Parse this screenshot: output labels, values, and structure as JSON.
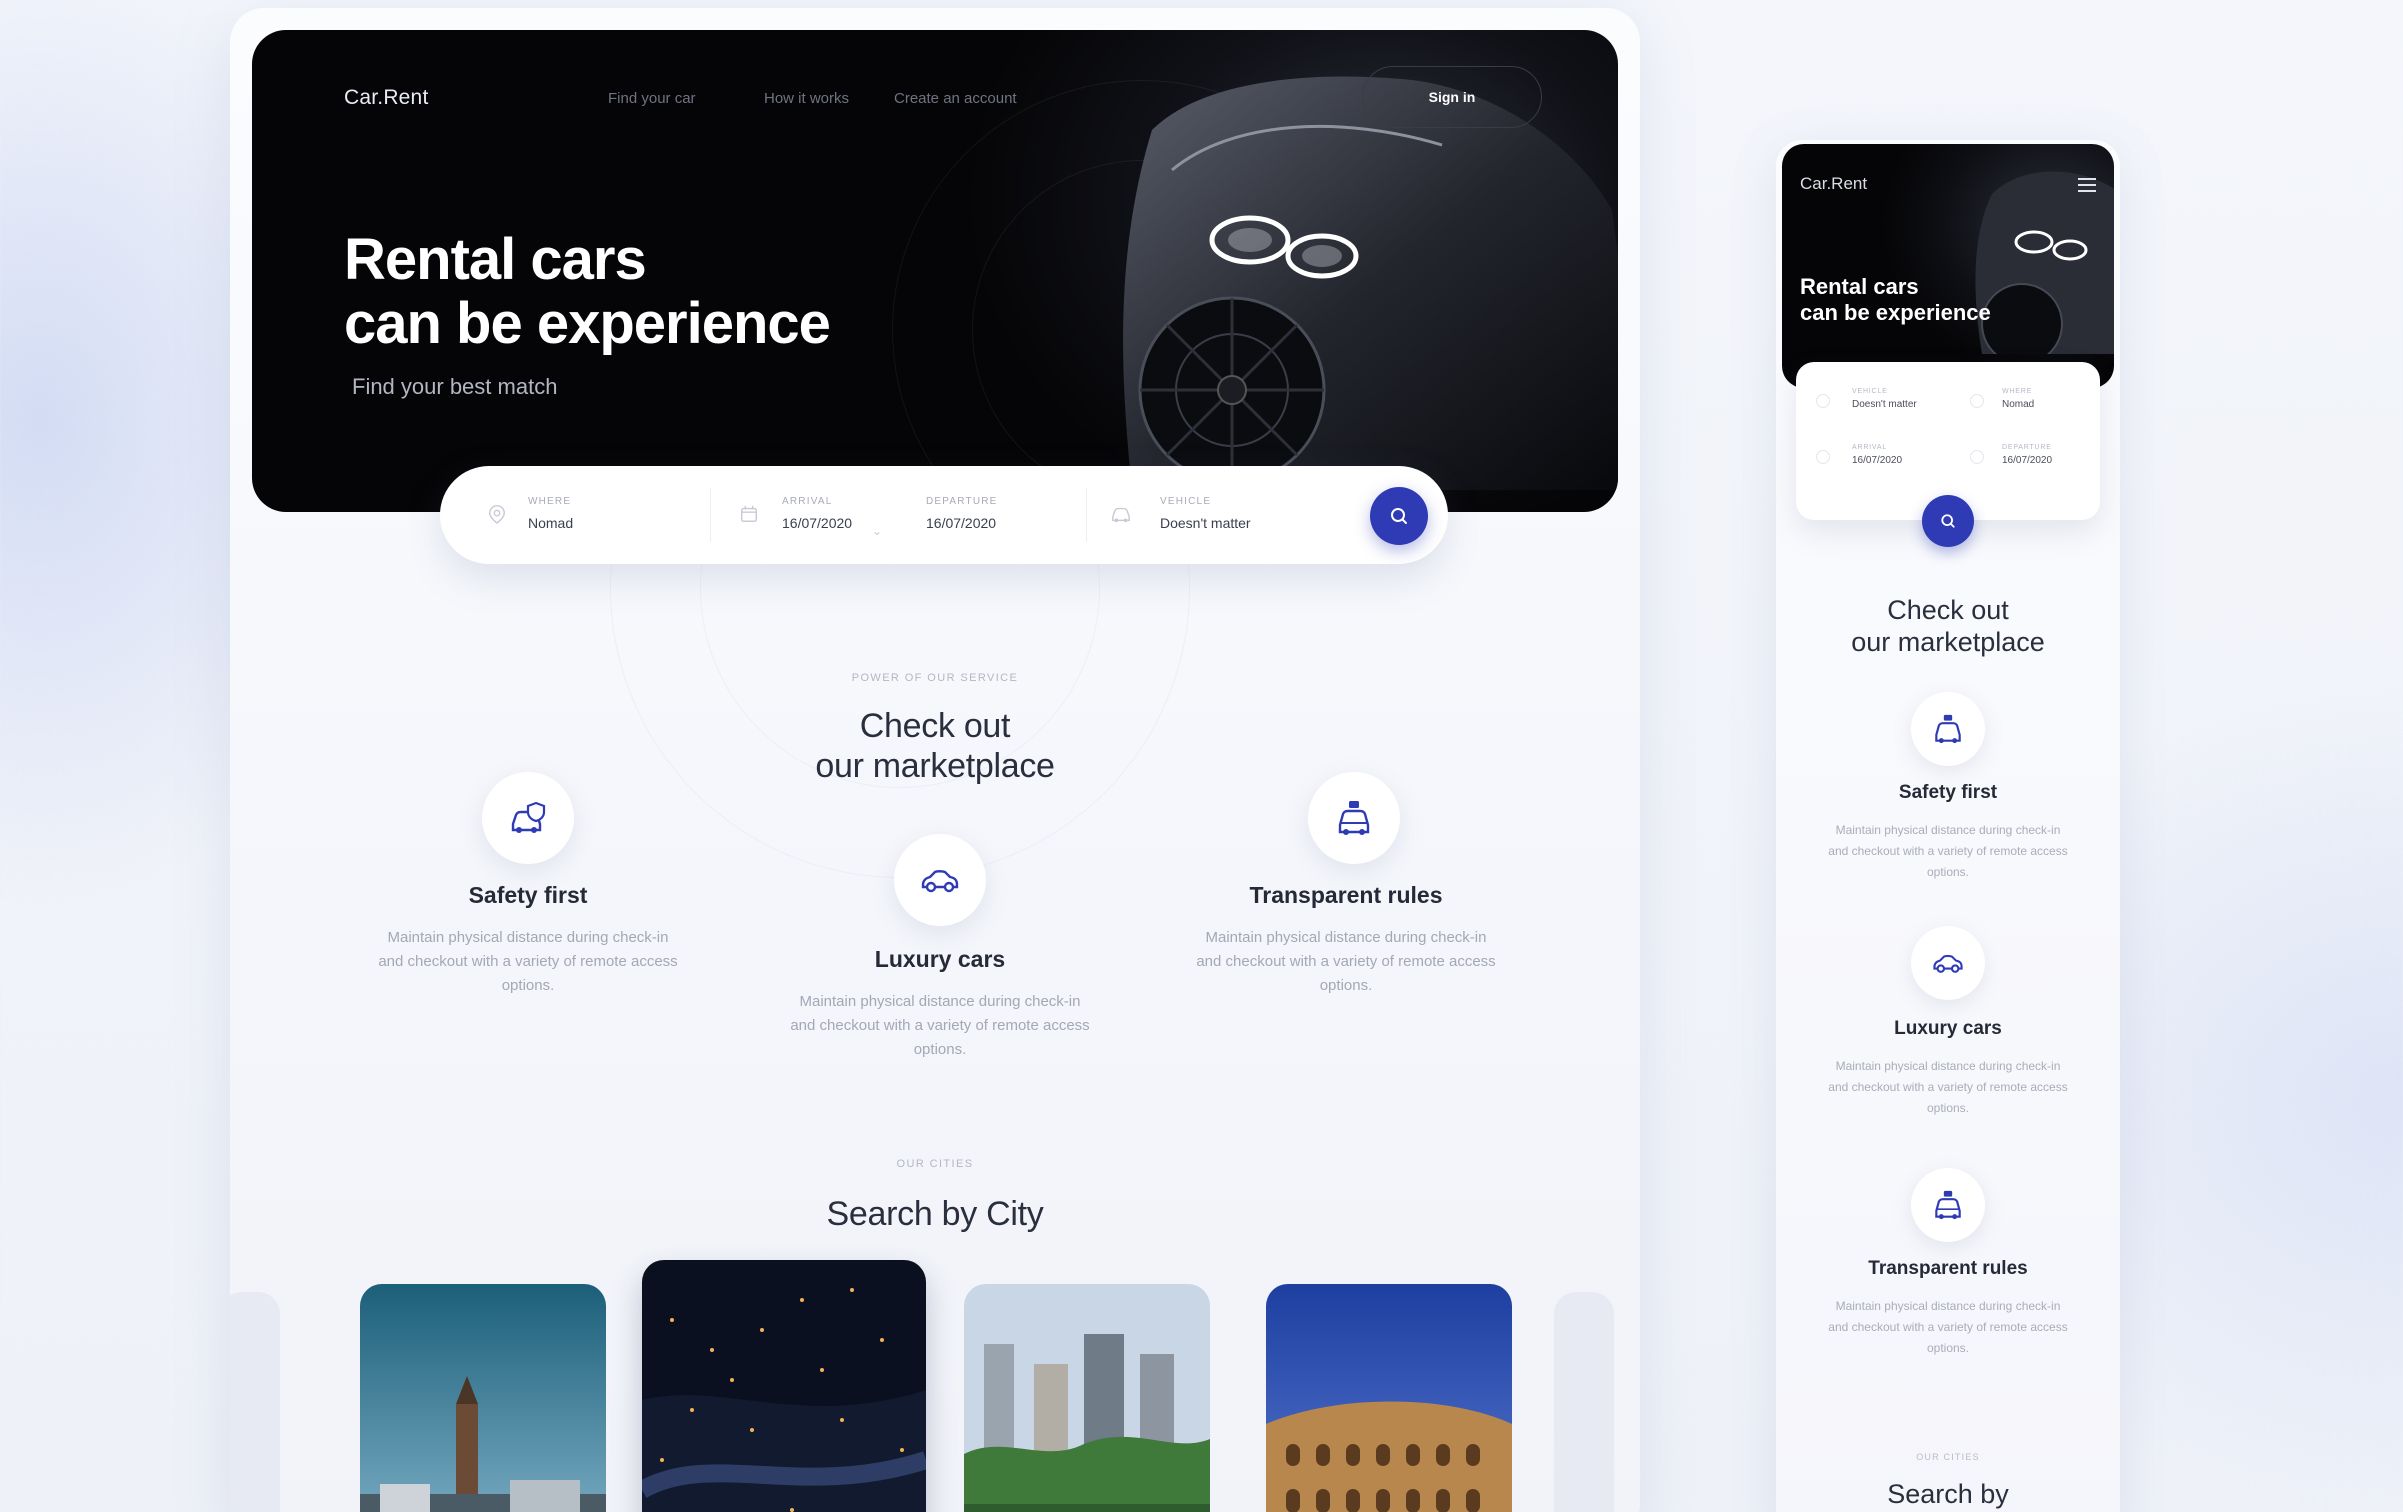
{
  "colors": {
    "accent": "#2f3bb5",
    "dark": "#050507",
    "heading": "#2a2f3e",
    "muted": "#a3a8b5"
  },
  "desktop": {
    "header": {
      "logo": "Car.Rent",
      "nav": [
        "Find your car",
        "How it works",
        "Create an account"
      ],
      "signin": "Sign in"
    },
    "hero": {
      "title_line1": "Rental cars",
      "title_line2": "can be experience",
      "subtitle": "Find your best match"
    },
    "search": {
      "where": {
        "label": "Where",
        "value": "Nomad",
        "icon": "location-pin-icon"
      },
      "arrival": {
        "label": "Arrival",
        "value": "16/07/2020",
        "icon": "calendar-icon"
      },
      "departure": {
        "label": "Departure",
        "value": "16/07/2020"
      },
      "vehicle": {
        "label": "Vehicle",
        "value": "Doesn't matter",
        "icon": "car-icon"
      },
      "button_icon": "search-icon"
    },
    "services": {
      "eyebrow": "Power of our service",
      "heading_line1": "Check out",
      "heading_line2": "our marketplace",
      "features": [
        {
          "title": "Safety first",
          "desc": "Maintain physical distance during check-in and checkout with a variety of remote access options.",
          "icon": "car-shield-icon"
        },
        {
          "title": "Luxury cars",
          "desc": "Maintain physical distance during check-in and checkout with a variety of remote access options.",
          "icon": "sports-car-icon"
        },
        {
          "title": "Transparent rules",
          "desc": "Maintain physical distance during check-in and checkout with a variety of remote access options.",
          "icon": "taxi-icon"
        }
      ]
    },
    "cities": {
      "eyebrow": "Our cities",
      "heading": "Search by City"
    }
  },
  "mobile": {
    "logo": "Car.Rent",
    "menu_icon": "hamburger-menu-icon",
    "title_line1": "Rental cars",
    "title_line2": "can be experience",
    "form": {
      "vehicle": {
        "label": "Vehicle",
        "value": "Doesn't matter"
      },
      "where": {
        "label": "Where",
        "value": "Nomad"
      },
      "arrival": {
        "label": "Arrival",
        "value": "16/07/2020"
      },
      "departure": {
        "label": "Departure",
        "value": "16/07/2020"
      }
    },
    "heading_line1": "Check out",
    "heading_line2": "our marketplace",
    "features": [
      {
        "title": "Safety first",
        "desc": "Maintain physical distance during check-in and checkout with a variety of remote access options."
      },
      {
        "title": "Luxury cars",
        "desc": "Maintain physical distance during check-in and checkout with a variety of remote access options."
      },
      {
        "title": "Transparent rules",
        "desc": "Maintain physical distance during check-in and checkout with a variety of remote access options."
      }
    ],
    "cities_eyebrow": "Our cities",
    "cities_heading": "Search by"
  }
}
